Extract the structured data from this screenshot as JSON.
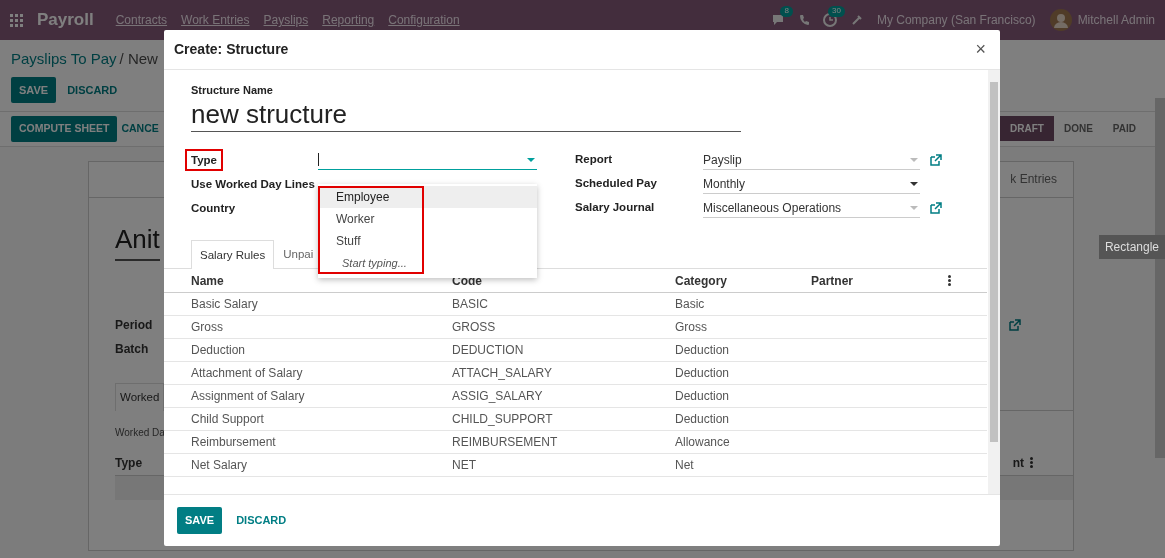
{
  "navbar": {
    "app_title": "Payroll",
    "menu": [
      "Contracts",
      "Work Entries",
      "Payslips",
      "Reporting",
      "Configuration"
    ],
    "messages_badge": "8",
    "activities_badge": "30",
    "company": "My Company (San Francisco)",
    "user": "Mitchell Admin"
  },
  "background": {
    "breadcrumb_parent": "Payslips To Pay",
    "breadcrumb_current": "/ New",
    "buttons": [
      "SAVE",
      "DISCARD"
    ],
    "actions": [
      "COMPUTE SHEET",
      "CANCE"
    ],
    "statuses": [
      {
        "label": "DRAFT",
        "selected": true
      },
      {
        "label": "DONE",
        "selected": false
      },
      {
        "label": "PAID",
        "selected": false
      }
    ],
    "smart_button": "k Entries",
    "title": "Anit",
    "fields": [
      "Period",
      "Batch"
    ],
    "tab": "Worked",
    "section": "Worked Da",
    "columns": [
      "Type",
      "nt"
    ],
    "tooltip": "Rectangle"
  },
  "dialog": {
    "title": "Create: Structure",
    "close": "×",
    "name_label": "Structure Name",
    "name_value": "new structure",
    "type_input": {
      "focused": true
    },
    "left_fields": [
      {
        "label": "Type",
        "highlighted": true
      },
      {
        "label": "Use Worked Day Lines",
        "highlighted": false
      },
      {
        "label": "Country",
        "highlighted": false
      }
    ],
    "dropdown": {
      "highlighted": true,
      "hint": "Start typing...",
      "options": [
        {
          "label": "Employee",
          "selected": true
        },
        {
          "label": "Worker",
          "selected": false
        },
        {
          "label": "Stuff",
          "selected": false
        }
      ]
    },
    "right_fields": [
      {
        "label": "Report",
        "value": "Payslip",
        "kind": "many2one"
      },
      {
        "label": "Scheduled Pay",
        "value": "Monthly",
        "kind": "selection"
      },
      {
        "label": "Salary Journal",
        "value": "Miscellaneous Operations",
        "kind": "many2one"
      }
    ],
    "tabs": [
      {
        "label": "Salary Rules",
        "selected": true
      },
      {
        "label": "Unpai",
        "selected": false
      }
    ],
    "columns": [
      "Name",
      "Code",
      "Category",
      "Partner"
    ],
    "rows": [
      {
        "name": "Basic Salary",
        "code": "BASIC",
        "category": "Basic"
      },
      {
        "name": "Gross",
        "code": "GROSS",
        "category": "Gross"
      },
      {
        "name": "Deduction",
        "code": "DEDUCTION",
        "category": "Deduction"
      },
      {
        "name": "Attachment of Salary",
        "code": "ATTACH_SALARY",
        "category": "Deduction"
      },
      {
        "name": "Assignment of Salary",
        "code": "ASSIG_SALARY",
        "category": "Deduction"
      },
      {
        "name": "Child Support",
        "code": "CHILD_SUPPORT",
        "category": "Deduction"
      },
      {
        "name": "Reimbursement",
        "code": "REIMBURSEMENT",
        "category": "Allowance"
      },
      {
        "name": "Net Salary",
        "code": "NET",
        "category": "Net"
      }
    ],
    "footer": [
      "SAVE",
      "DISCARD"
    ]
  }
}
